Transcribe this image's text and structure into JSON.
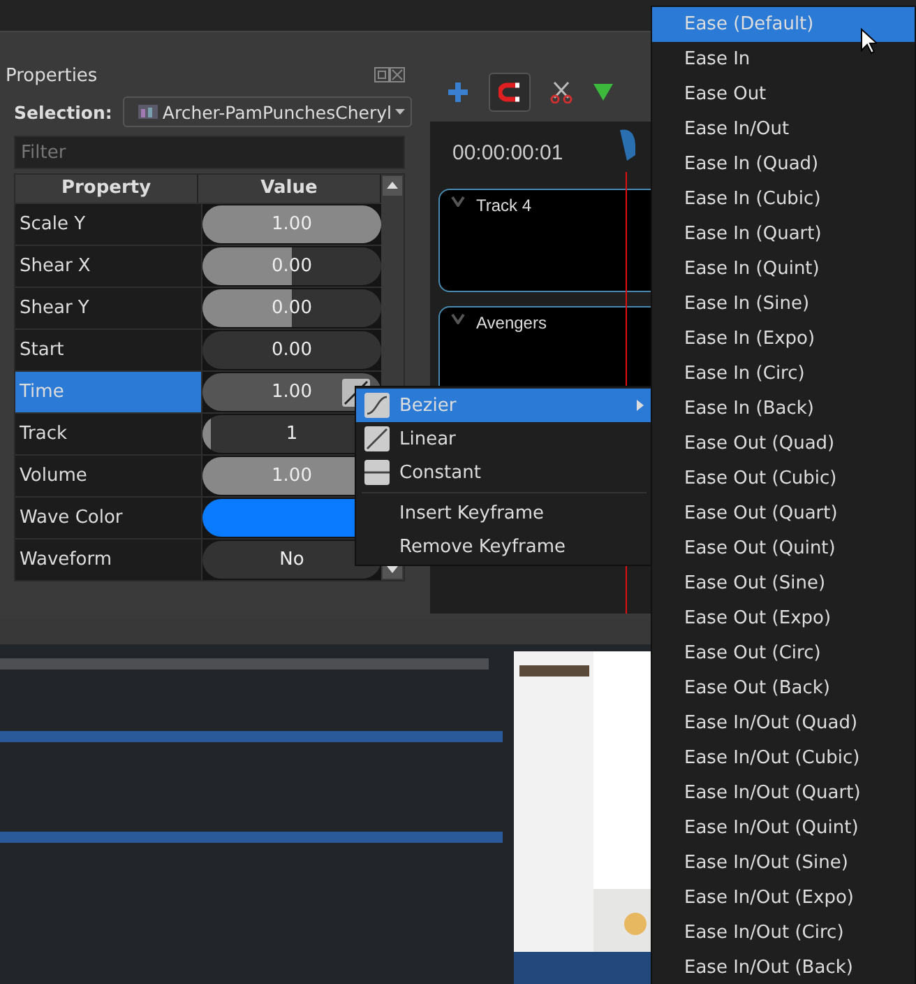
{
  "properties": {
    "title": "Properties",
    "selection_label": "Selection:",
    "selection_value": "Archer-PamPunchesCheryl",
    "filter": {
      "placeholder": "Filter"
    },
    "columns": [
      "Property",
      "Value"
    ],
    "rows": [
      {
        "name": "Scale Y",
        "kind": "slider",
        "value": "1.00",
        "level": 1,
        "selected": false
      },
      {
        "name": "Shear X",
        "kind": "slider",
        "value": "0.00",
        "level": 0.5,
        "selected": false
      },
      {
        "name": "Shear Y",
        "kind": "slider",
        "value": "0.00",
        "level": 0.5,
        "selected": false
      },
      {
        "name": "Start",
        "kind": "slider",
        "value": "0.00",
        "selected": false
      },
      {
        "name": "Time",
        "kind": "slider",
        "value": "1.00",
        "selected": true
      },
      {
        "name": "Track",
        "kind": "slider",
        "value": "1",
        "level": 0.05,
        "selected": false
      },
      {
        "name": "Volume",
        "kind": "slider",
        "value": "1.00",
        "level": 1,
        "selected": false
      },
      {
        "name": "Wave Color",
        "kind": "color",
        "color": "#0a7bff",
        "selected": false
      },
      {
        "name": "Waveform",
        "kind": "choice",
        "value": "No",
        "selected": false
      }
    ]
  },
  "timeline": {
    "time": "00:00:00:01",
    "tracks": [
      "Track 4",
      "Avengers"
    ]
  },
  "context_menu": [
    {
      "label": "Bezier",
      "kind": "bezier",
      "selected": true,
      "submenu": true
    },
    {
      "label": "Linear",
      "kind": "linear",
      "selected": false,
      "submenu": false
    },
    {
      "label": "Constant",
      "kind": "constant",
      "selected": false,
      "submenu": false
    },
    {
      "label": "Insert Keyframe",
      "kind": "plain",
      "selected": false,
      "submenu": false
    },
    {
      "label": "Remove Keyframe",
      "kind": "plain",
      "selected": false,
      "submenu": false
    }
  ],
  "submenu": [
    {
      "label": "Ease (Default)",
      "selected": true
    },
    {
      "label": "Ease In",
      "selected": false
    },
    {
      "label": "Ease Out",
      "selected": false
    },
    {
      "label": "Ease In/Out",
      "selected": false
    },
    {
      "label": "Ease In (Quad)",
      "selected": false
    },
    {
      "label": "Ease In (Cubic)",
      "selected": false
    },
    {
      "label": "Ease In (Quart)",
      "selected": false
    },
    {
      "label": "Ease In (Quint)",
      "selected": false
    },
    {
      "label": "Ease In (Sine)",
      "selected": false
    },
    {
      "label": "Ease In (Expo)",
      "selected": false
    },
    {
      "label": "Ease In (Circ)",
      "selected": false
    },
    {
      "label": "Ease In (Back)",
      "selected": false
    },
    {
      "label": "Ease Out (Quad)",
      "selected": false
    },
    {
      "label": "Ease Out (Cubic)",
      "selected": false
    },
    {
      "label": "Ease Out (Quart)",
      "selected": false
    },
    {
      "label": "Ease Out (Quint)",
      "selected": false
    },
    {
      "label": "Ease Out (Sine)",
      "selected": false
    },
    {
      "label": "Ease Out (Expo)",
      "selected": false
    },
    {
      "label": "Ease Out (Circ)",
      "selected": false
    },
    {
      "label": "Ease Out (Back)",
      "selected": false
    },
    {
      "label": "Ease In/Out (Quad)",
      "selected": false
    },
    {
      "label": "Ease In/Out (Cubic)",
      "selected": false
    },
    {
      "label": "Ease In/Out (Quart)",
      "selected": false
    },
    {
      "label": "Ease In/Out (Quint)",
      "selected": false
    },
    {
      "label": "Ease In/Out (Sine)",
      "selected": false
    },
    {
      "label": "Ease In/Out (Expo)",
      "selected": false
    },
    {
      "label": "Ease In/Out (Circ)",
      "selected": false
    },
    {
      "label": "Ease In/Out (Back)",
      "selected": false
    }
  ]
}
